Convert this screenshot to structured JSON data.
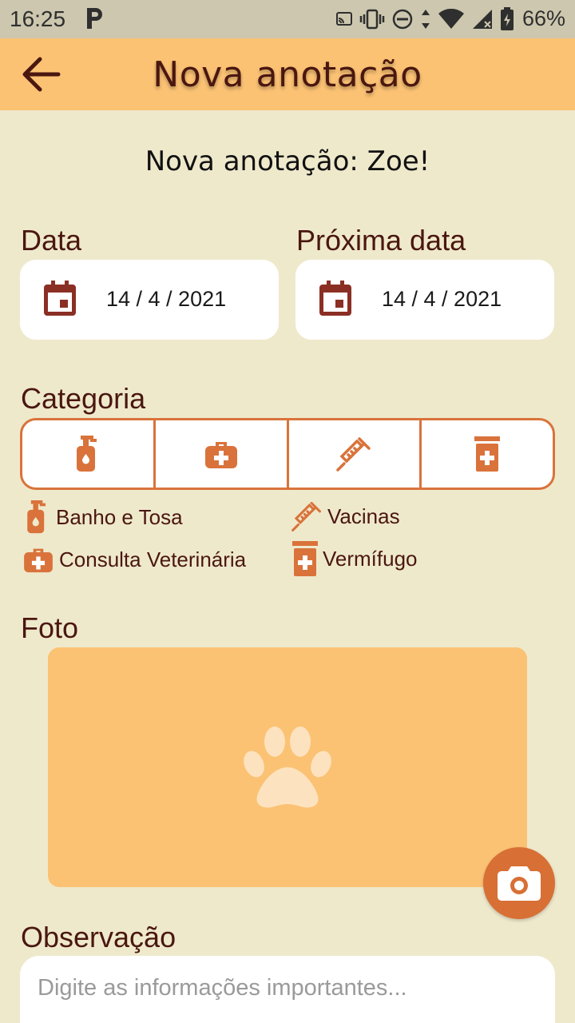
{
  "status_bar": {
    "time": "16:25",
    "battery_text": "66%",
    "icons": [
      "p-app-icon",
      "cast-icon",
      "vibrate-icon",
      "dnd-icon",
      "data-arrows-icon",
      "wifi-icon",
      "signal-icon",
      "battery-charging-icon"
    ]
  },
  "app_bar": {
    "title": "Nova anotação",
    "back_icon": "arrow-back-icon"
  },
  "heading": "Nova anotação: Zoe!",
  "dates": {
    "data_label": "Data",
    "data_value": "14 / 4 / 2021",
    "next_label": "Próxima data",
    "next_value": "14 / 4 / 2021",
    "icon": "calendar-icon"
  },
  "category": {
    "label": "Categoria",
    "options": [
      {
        "icon": "shampoo-bottle-icon",
        "name": "Banho e Tosa"
      },
      {
        "icon": "medical-bag-icon",
        "name": "Consulta Veterinária"
      },
      {
        "icon": "syringe-icon",
        "name": "Vacinas"
      },
      {
        "icon": "medicine-bottle-icon",
        "name": "Vermífugo"
      }
    ]
  },
  "photo": {
    "label": "Foto",
    "placeholder_icon": "paw-icon",
    "camera_icon": "camera-icon"
  },
  "observation": {
    "label": "Observação",
    "placeholder": "Digite as informações importantes..."
  },
  "colors": {
    "background": "#EFE9CC",
    "app_bar": "#FBC274",
    "accent": "#D9733B",
    "text": "#4A1710",
    "calendar": "#8B2F24"
  }
}
